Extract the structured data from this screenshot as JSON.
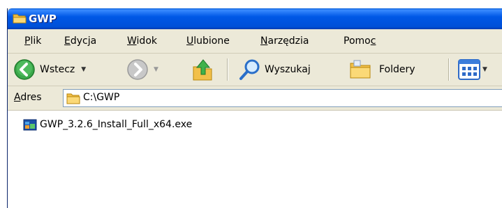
{
  "window": {
    "title": "GWP",
    "title_icon": "folder-icon"
  },
  "menubar": {
    "items": [
      {
        "pre": "",
        "accel": "P",
        "post": "lik"
      },
      {
        "pre": "",
        "accel": "E",
        "post": "dycja"
      },
      {
        "pre": "",
        "accel": "W",
        "post": "idok"
      },
      {
        "pre": "",
        "accel": "U",
        "post": "lubione"
      },
      {
        "pre": "",
        "accel": "N",
        "post": "arzędzia"
      },
      {
        "pre": "Pomo",
        "accel": "c",
        "post": ""
      }
    ]
  },
  "toolbar": {
    "back_label": "Wstecz",
    "search_label": "Wyszukaj",
    "folders_label": "Foldery",
    "icons": [
      "back-arrow-icon",
      "forward-arrow-icon",
      "up-folder-icon",
      "search-magnifier-icon",
      "folders-icon",
      "views-icon"
    ]
  },
  "addressbar": {
    "label_accel": "A",
    "label_rest": "dres",
    "path": "C:\\GWP"
  },
  "content": {
    "files": [
      {
        "name": "GWP_3.2.6_Install_Full_x64.exe",
        "icon": "exe-file-icon"
      }
    ]
  },
  "colors": {
    "titlebar": "#0058e6",
    "chrome": "#ece9d8",
    "folder": "#f5c453"
  }
}
